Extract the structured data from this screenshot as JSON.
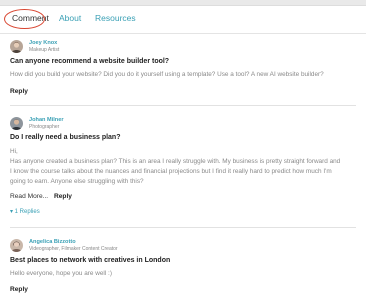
{
  "tabs": [
    {
      "label": "Comment"
    },
    {
      "label": "About"
    },
    {
      "label": "Resources"
    }
  ],
  "posts": [
    {
      "author": "Joey Knox",
      "role": "Makeup Artist",
      "title": "Can anyone recommend a website builder tool?",
      "body": [
        "How did you build your website? Did you do it yourself using a template? Use a tool? A new AI website builder?"
      ],
      "reply_label": "Reply"
    },
    {
      "author": "Johan Milner",
      "role": "Photographer",
      "title": "Do I really need a business plan?",
      "body": [
        "Hi,",
        "Has anyone created a business plan? This is an area I really struggle with. My business is pretty straight forward and",
        "I know the course talks about the nuances and financial projections but I find it really hard to predict how much I'm",
        "going to earn. Anyone else struggling with this?"
      ],
      "read_more_label": "Read More...",
      "reply_label": "Reply",
      "replies_label": "▾ 1 Replies"
    },
    {
      "author": "Angelica Bizzotto",
      "role": "Videographer, Filmaker Content Creator",
      "title": "Best places to network with creatives in London",
      "body": [
        "Hello everyone, hope you are well :)"
      ],
      "reply_label": "Reply"
    }
  ],
  "colors": {
    "accent": "#3aa0b5",
    "highlight_circle": "#d8442f"
  }
}
